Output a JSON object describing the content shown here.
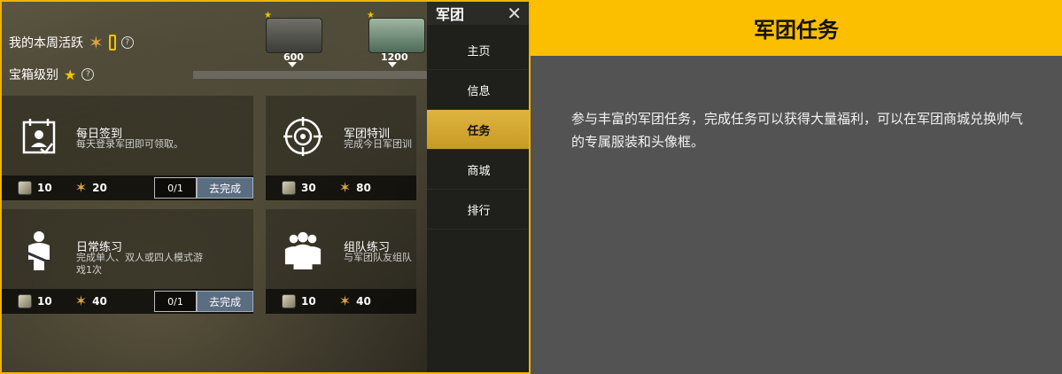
{
  "game": {
    "weekly_activity_label": "我的本周活跃",
    "box_level_label": "宝箱级别",
    "help_symbol": "?",
    "chests": [
      {
        "value": "600"
      },
      {
        "value": "1200"
      }
    ],
    "tasks": [
      {
        "title": "每日签到",
        "desc": "每天登录军团即可领取。",
        "ammo": "10",
        "gold": "20",
        "progress": "0/1",
        "action": "去完成"
      },
      {
        "title": "军团特训",
        "desc": "完成今日军团训",
        "ammo": "30",
        "gold": "80"
      },
      {
        "title": "日常练习",
        "desc": "完成单人、双人或四人模式游\n戏1次",
        "ammo": "10",
        "gold": "40",
        "progress": "0/1",
        "action": "去完成"
      },
      {
        "title": "组队练习",
        "desc": "与军团队友组队",
        "ammo": "10",
        "gold": "40"
      }
    ],
    "side_menu": {
      "title": "军团",
      "close_symbol": "✕",
      "items": [
        "主页",
        "信息",
        "任务",
        "商城",
        "排行"
      ],
      "active_index": 2
    }
  },
  "info": {
    "title": "军团任务",
    "description": "参与丰富的军团任务，完成任务可以获得大量福利，可以在军团商城兑换帅气的专属服装和头像框。"
  },
  "colors": {
    "accent": "#fcbf00",
    "panel_bg": "#535353"
  }
}
